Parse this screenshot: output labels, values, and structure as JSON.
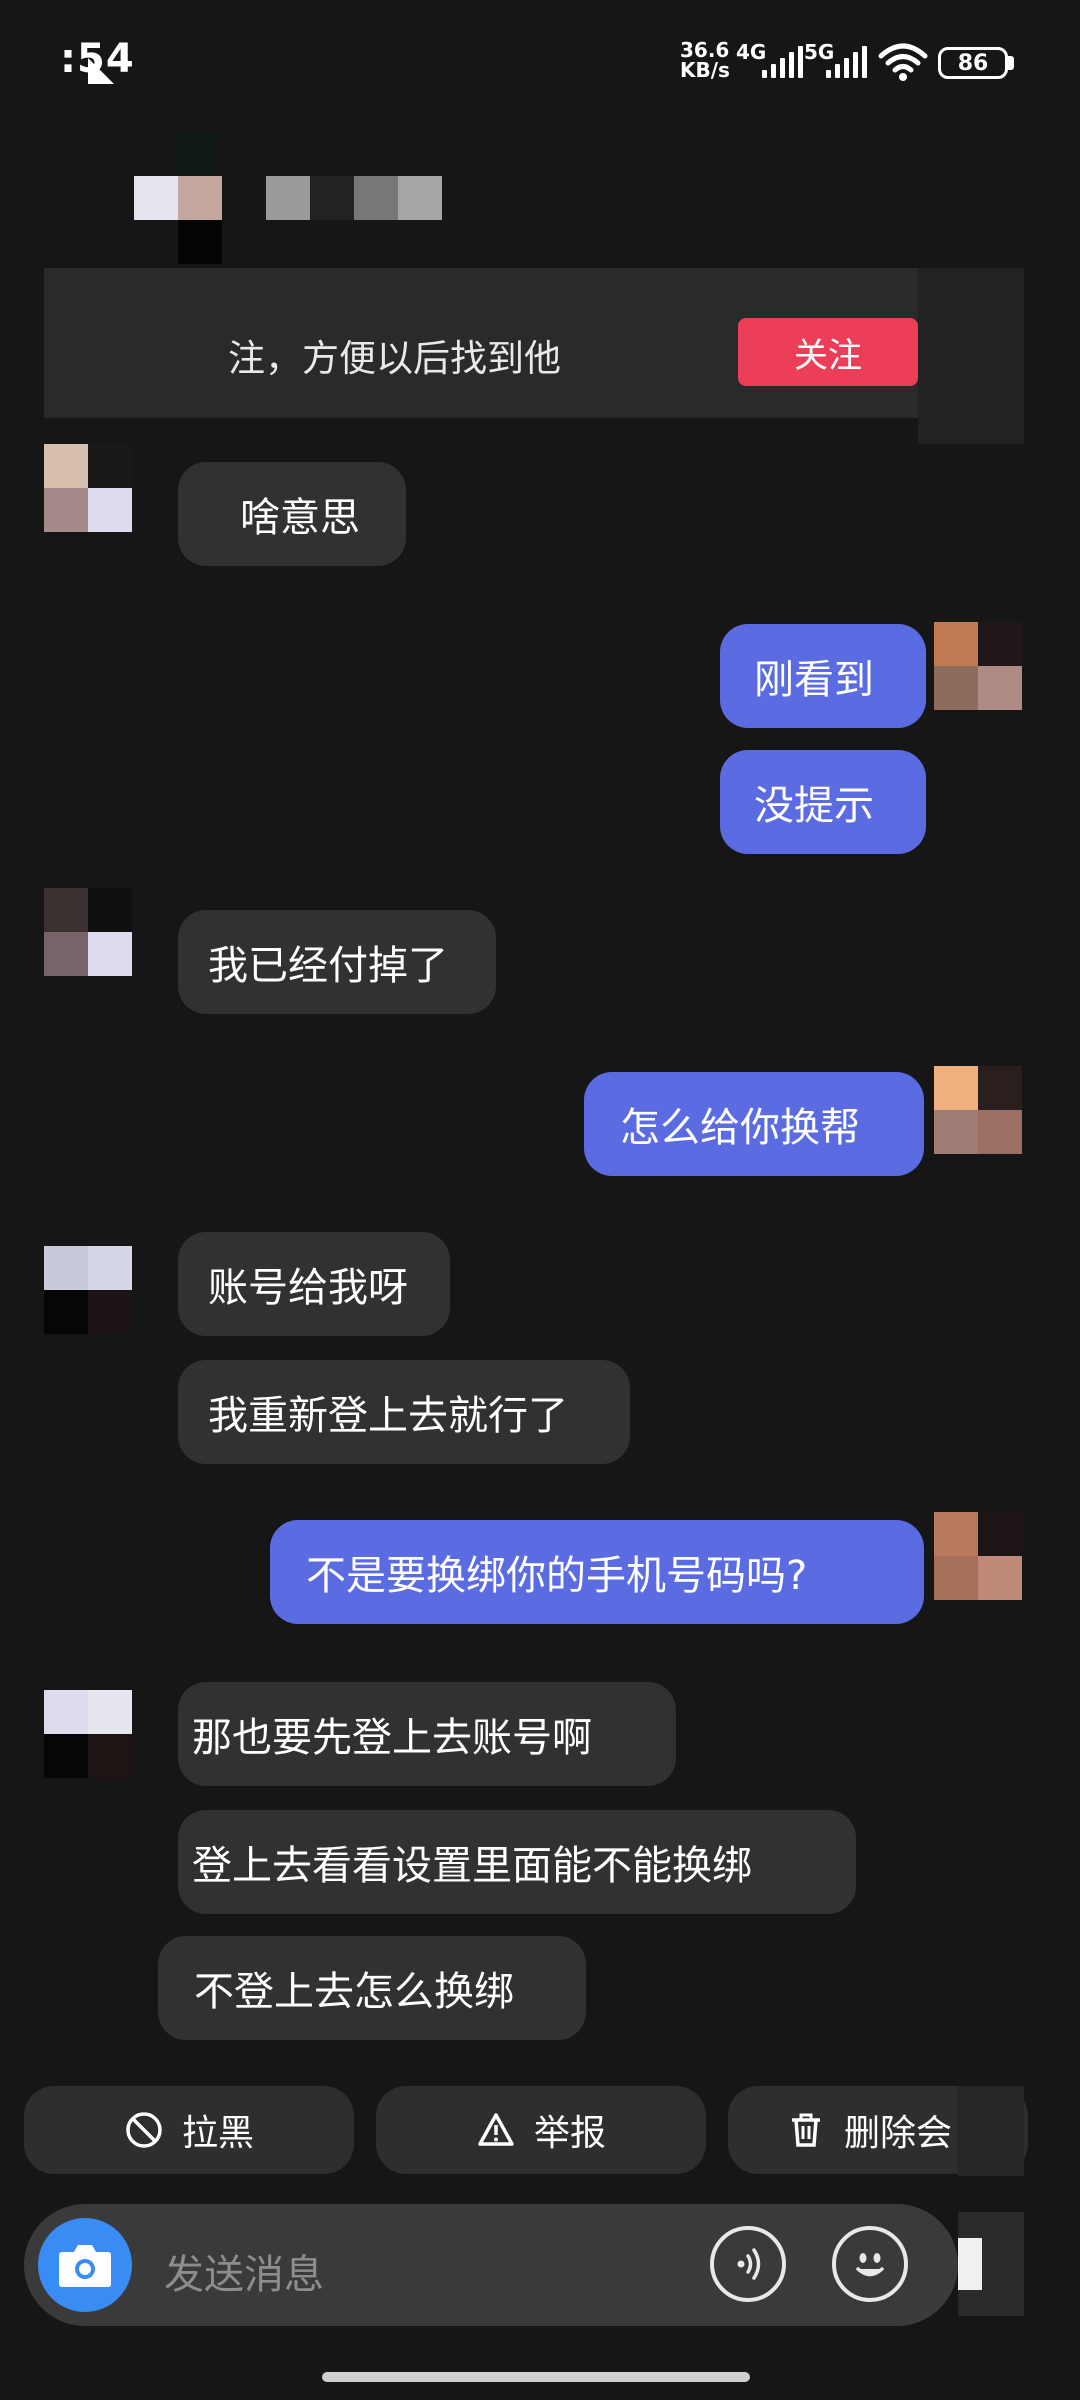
{
  "status_bar": {
    "time": ":54",
    "net_speed": "36.6",
    "net_unit": "KB/s",
    "net_type_1": "4G",
    "net_type_2": "5G",
    "battery": "86"
  },
  "banner": {
    "text": "注，方便以后找到他",
    "follow_label": "关注",
    "follow_color": "#ec3e59"
  },
  "messages": [
    {
      "side": "in",
      "text": "啥意思"
    },
    {
      "side": "out",
      "text": "刚看到"
    },
    {
      "side": "out",
      "text": "没提示"
    },
    {
      "side": "in",
      "text": "我已经付掉了"
    },
    {
      "side": "out",
      "text": "怎么给你换帮"
    },
    {
      "side": "in",
      "text": "账号给我呀"
    },
    {
      "side": "in",
      "text": "我重新登上去就行了"
    },
    {
      "side": "out",
      "text": "不是要换绑你的手机号码吗?"
    },
    {
      "side": "in",
      "text": "那也要先登上去账号啊"
    },
    {
      "side": "in",
      "text": "登上去看看设置里面能不能换绑"
    },
    {
      "side": "in",
      "text": "不登上去怎么换绑"
    }
  ],
  "actions": {
    "block_label": "拉黑",
    "report_label": "举报",
    "delete_label": "删除会"
  },
  "composer": {
    "placeholder": "发送消息",
    "camera_icon": "camera-icon",
    "voice_icon": "voice-icon",
    "emoji_icon": "emoji-icon"
  },
  "colors": {
    "outgoing_bubble": "#5b6ce3",
    "incoming_bubble": "#313131",
    "camera_button": "#3a8cf5"
  }
}
